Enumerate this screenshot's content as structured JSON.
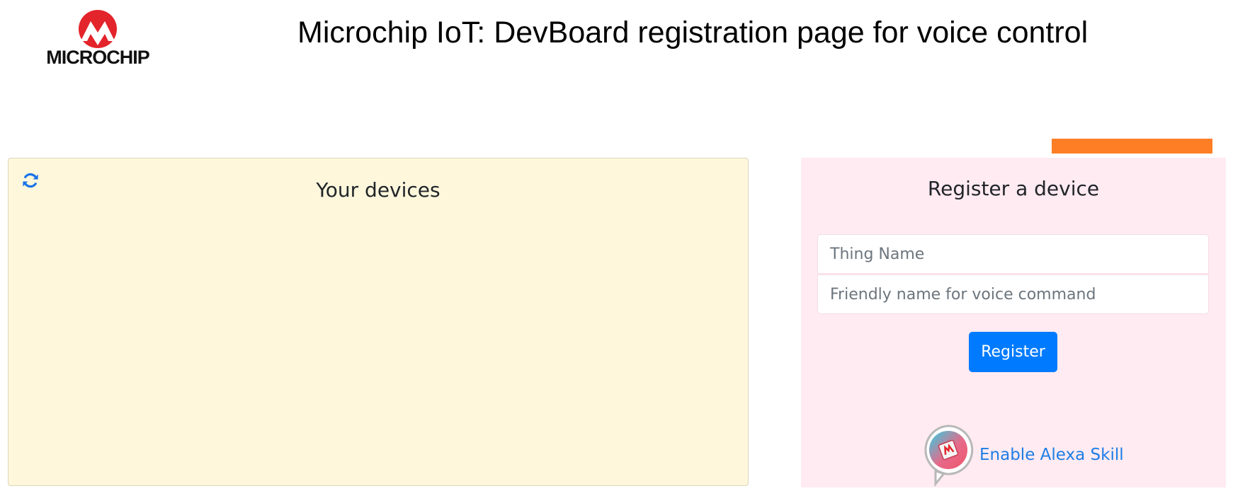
{
  "brand": {
    "name": "MICROCHIP"
  },
  "header": {
    "title": "Microchip IoT: DevBoard registration page for voice control"
  },
  "devices": {
    "title": "Your devices",
    "refresh_icon": "refresh-icon",
    "items": []
  },
  "register": {
    "title": "Register a device",
    "thing_name_placeholder": "Thing Name",
    "friendly_name_placeholder": "Friendly name for voice command",
    "button_label": "Register",
    "alexa_link_label": "Enable Alexa Skill",
    "alexa_icon": "alexa-skill-icon"
  },
  "colors": {
    "devices_panel_bg": "#fef7dc",
    "register_panel_bg": "#ffebf1",
    "accent_orange": "#fd7e24",
    "primary_blue": "#007bff",
    "brand_red": "#e3242b"
  }
}
